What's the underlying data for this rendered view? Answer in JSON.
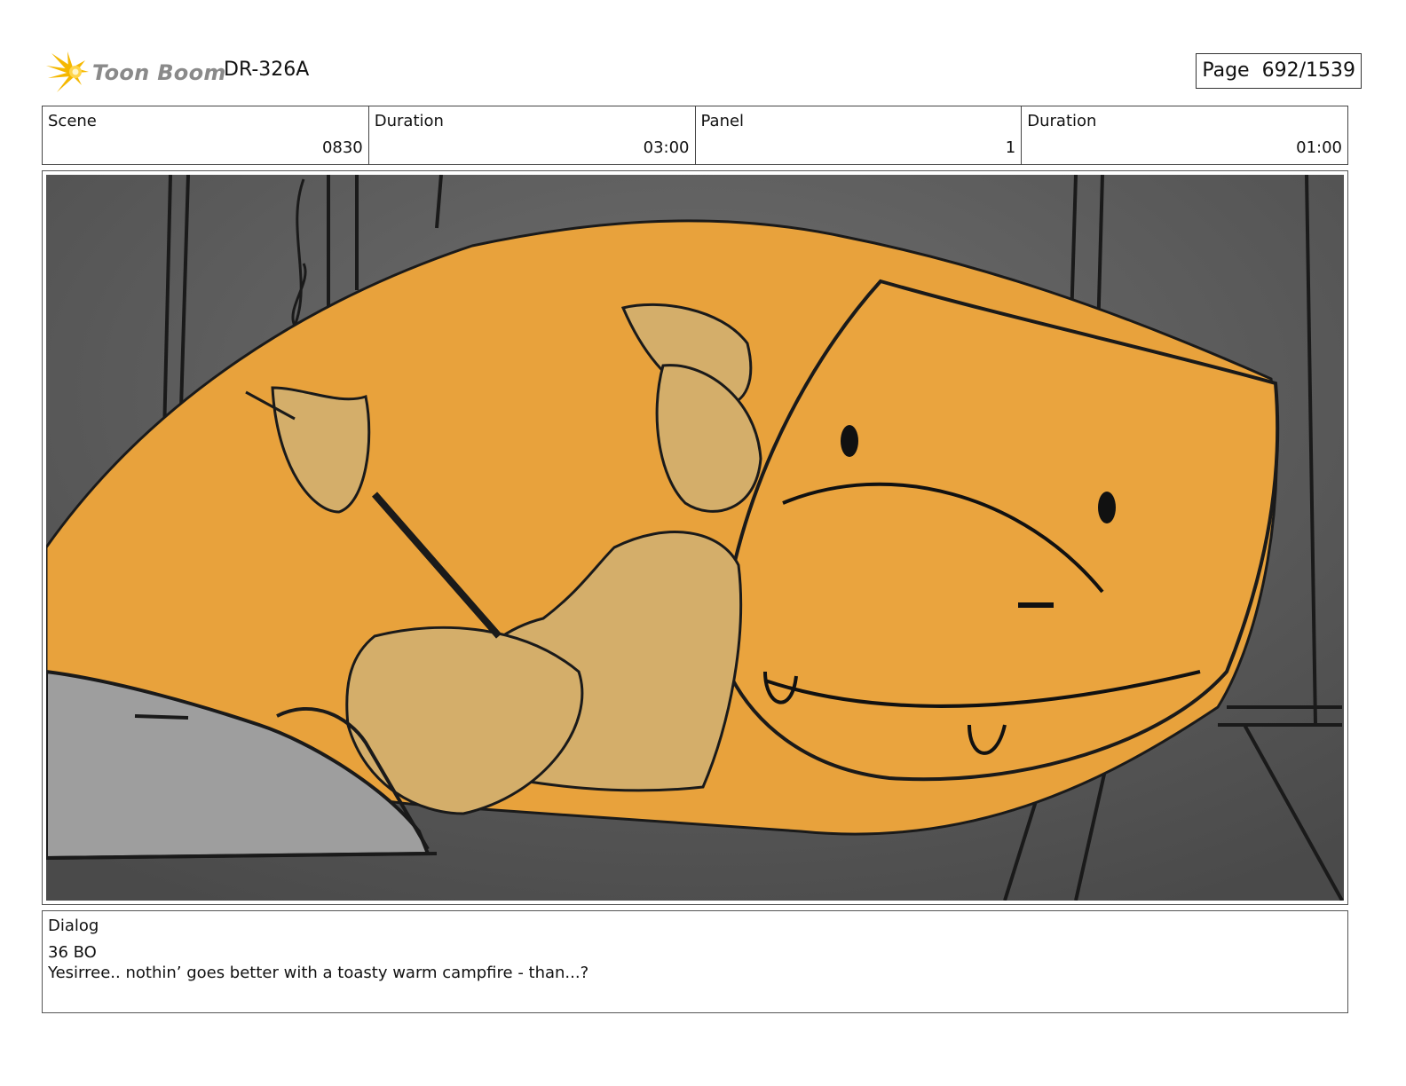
{
  "header": {
    "logo_text": "Toon Boom",
    "document_id": "DR-326A",
    "page_label": "Page",
    "page_number": "692/1539"
  },
  "info": [
    {
      "label": "Scene",
      "value": "0830"
    },
    {
      "label": "Duration",
      "value": "03:00"
    },
    {
      "label": "Panel",
      "value": "1"
    },
    {
      "label": "Duration",
      "value": "01:00"
    }
  ],
  "panel": {
    "icon": "storyboard-panel-image",
    "colors": {
      "background": "#5a5a5a",
      "dino": "#e8a23c",
      "character": "#d4ae6a",
      "fire": "#f07a2a",
      "rock": "#9e9e9e"
    }
  },
  "dialog": {
    "label": "Dialog",
    "speaker": "36 BO",
    "line": "Yesirree.. nothin’ goes better with a toasty warm campfire - than...?"
  },
  "logo_colors": {
    "flare": "#f5b800",
    "text": "#8a8a8a"
  }
}
